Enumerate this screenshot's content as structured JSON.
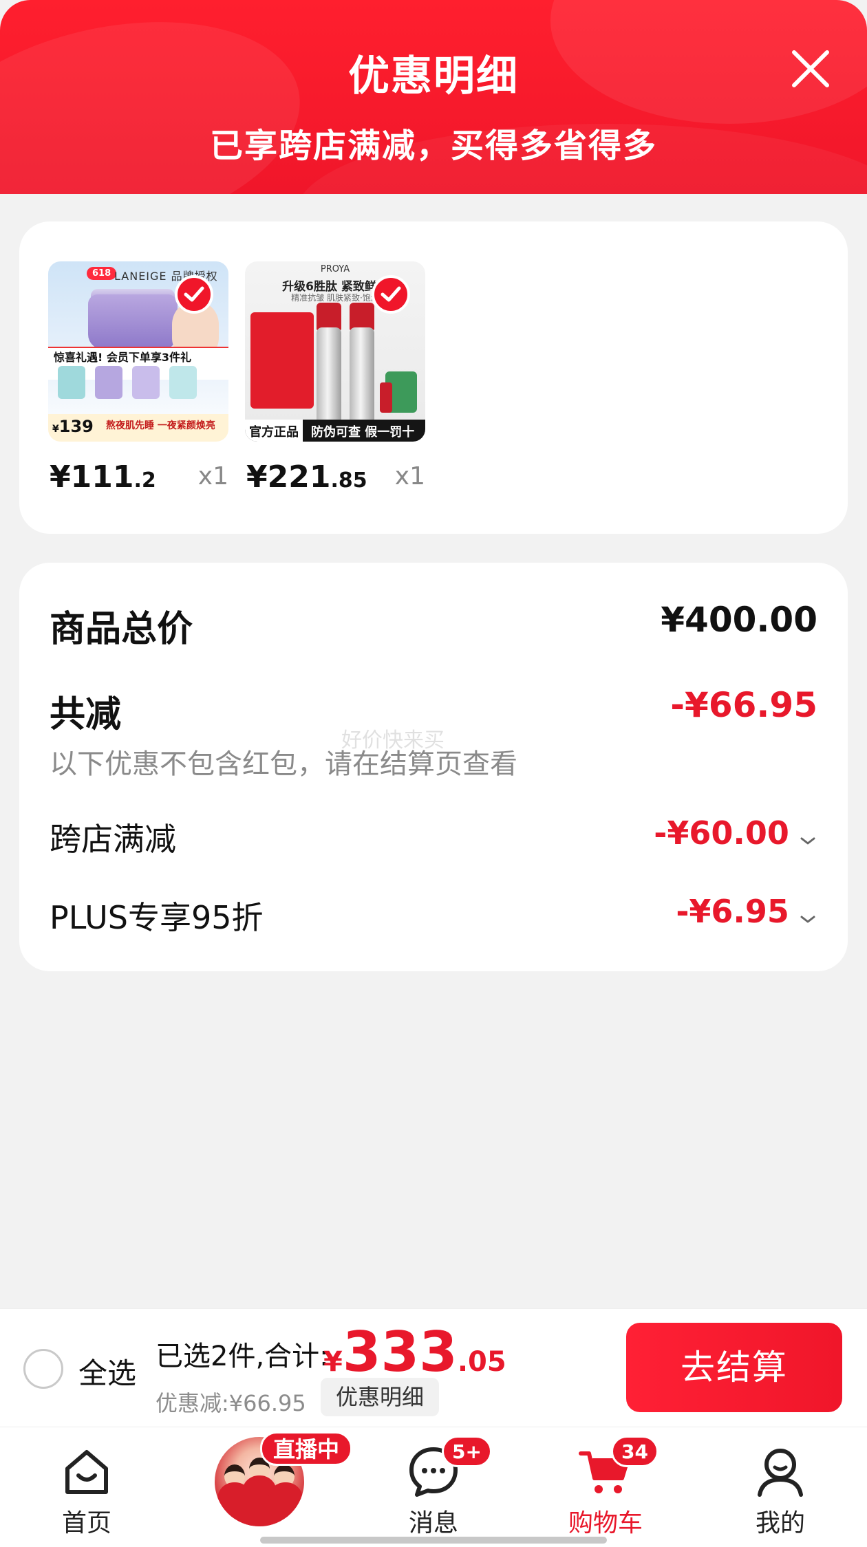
{
  "header": {
    "title": "优惠明细",
    "subtitle": "已享跨店满减，买得多省得多"
  },
  "products": [
    {
      "brand": "LANEIGE",
      "tag": "618",
      "auth": "品牌授权",
      "promo": "惊喜礼遇! 会员下单享3件礼",
      "strip": "熬夜肌先睡 一夜紧颜焕亮",
      "list_price": "139",
      "price_int": "¥111",
      "price_dec": ".2",
      "qty": "x1",
      "selected": true
    },
    {
      "brand": "PROYA",
      "headline": "升级6胜肽 紧致鲜颜",
      "sub": "精准抗皱 肌肤紧致·饱满",
      "tag_a": "官方正品",
      "tag_b": "防伪可查 假一罚十",
      "price_int": "¥221",
      "price_dec": ".85",
      "qty": "x1",
      "selected": true
    }
  ],
  "summary": {
    "total_label": "商品总价",
    "total_value": "¥400.00",
    "reduce_label": "共减",
    "reduce_value": "-¥66.95",
    "note": "以下优惠不包含红包，请在结算页查看",
    "watermark": "好价快来买",
    "items": [
      {
        "label": "跨店满减",
        "value": "-¥60.00"
      },
      {
        "label": "PLUS专享95折",
        "value": "-¥6.95"
      }
    ]
  },
  "checkout": {
    "select_all": "全选",
    "selected_text": "已选2件,合计:",
    "total_currency": "¥",
    "total_int": "333",
    "total_dec": ".05",
    "discount_text": "优惠减:¥66.95",
    "detail_button": "优惠明细",
    "pay_button": "去结算"
  },
  "tabbar": {
    "home": "首页",
    "live_badge": "直播中",
    "messages": "消息",
    "messages_badge": "5+",
    "cart": "购物车",
    "cart_badge": "34",
    "mine": "我的"
  },
  "colors": {
    "brand_red": "#e8182b",
    "header_red": "#f0162a"
  }
}
